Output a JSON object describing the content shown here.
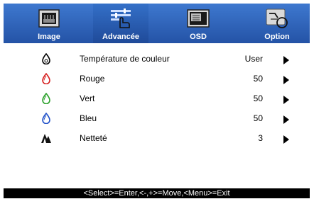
{
  "tabs": [
    {
      "label": "Image",
      "icon": "monitor-icon"
    },
    {
      "label": "Advancée",
      "icon": "settings-hand-icon"
    },
    {
      "label": "OSD",
      "icon": "osd-screen-icon"
    },
    {
      "label": "Option",
      "icon": "option-tools-icon"
    }
  ],
  "active_tab": "Advancée",
  "menu": {
    "items": [
      {
        "label": "Température de couleur",
        "value": "User",
        "icon": "color-drop-icon",
        "icon_color": "#000000"
      },
      {
        "label": "Rouge",
        "value": "50",
        "icon": "red-drop-icon",
        "icon_color": "#d62020"
      },
      {
        "label": "Vert",
        "value": "50",
        "icon": "green-drop-icon",
        "icon_color": "#2aa02a"
      },
      {
        "label": "Bleu",
        "value": "50",
        "icon": "blue-drop-icon",
        "icon_color": "#2050c8"
      },
      {
        "label": "Netteté",
        "value": "3",
        "icon": "sharpness-icon",
        "icon_color": "#000000"
      }
    ]
  },
  "footer": {
    "hint": "<Select>=Enter,<-,+>=Move,<Menu>=Exit"
  },
  "colors": {
    "tab_bar": "#2f63bb",
    "footer_bg": "#000000"
  }
}
